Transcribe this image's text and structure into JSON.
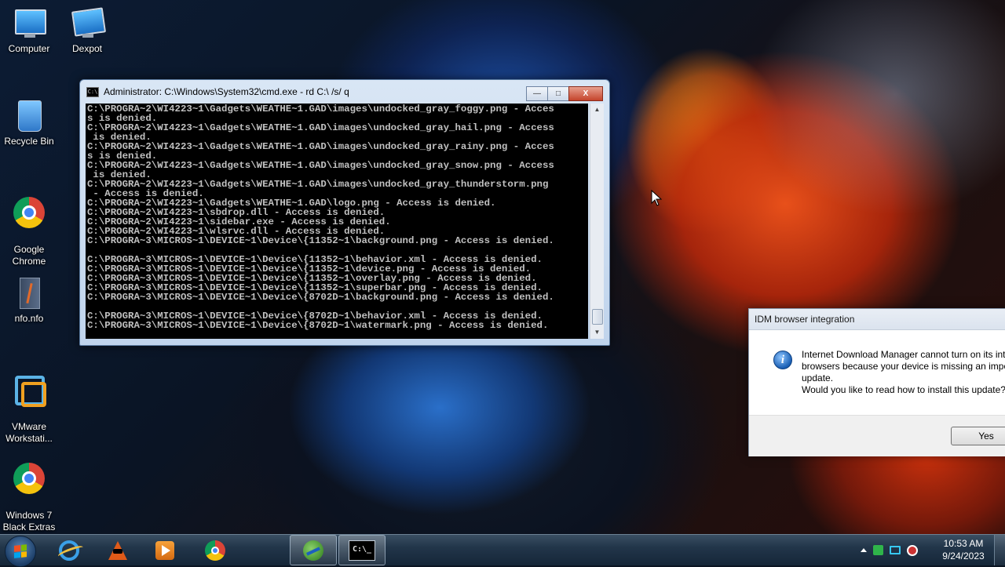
{
  "desktop_icons": [
    {
      "label": "Computer"
    },
    {
      "label": "Dexpot"
    },
    {
      "label": "Recycle Bin"
    },
    {
      "label": "Google\nChrome"
    },
    {
      "label": "nfo.nfo"
    },
    {
      "label": "VMware\nWorkstati..."
    },
    {
      "label": "Windows 7\nBlack Extras"
    }
  ],
  "cmd": {
    "title": "Administrator: C:\\Windows\\System32\\cmd.exe - rd  C:\\ /s/ q",
    "icon_text": "C:\\",
    "output": "C:\\PROGRA~2\\WI4223~1\\Gadgets\\WEATHE~1.GAD\\images\\undocked_gray_foggy.png - Acces\ns is denied.\nC:\\PROGRA~2\\WI4223~1\\Gadgets\\WEATHE~1.GAD\\images\\undocked_gray_hail.png - Access\n is denied.\nC:\\PROGRA~2\\WI4223~1\\Gadgets\\WEATHE~1.GAD\\images\\undocked_gray_rainy.png - Acces\ns is denied.\nC:\\PROGRA~2\\WI4223~1\\Gadgets\\WEATHE~1.GAD\\images\\undocked_gray_snow.png - Access\n is denied.\nC:\\PROGRA~2\\WI4223~1\\Gadgets\\WEATHE~1.GAD\\images\\undocked_gray_thunderstorm.png\n - Access is denied.\nC:\\PROGRA~2\\WI4223~1\\Gadgets\\WEATHE~1.GAD\\logo.png - Access is denied.\nC:\\PROGRA~2\\WI4223~1\\sbdrop.dll - Access is denied.\nC:\\PROGRA~2\\WI4223~1\\sidebar.exe - Access is denied.\nC:\\PROGRA~2\\WI4223~1\\wlsrvc.dll - Access is denied.\nC:\\PROGRA~3\\MICROS~1\\DEVICE~1\\Device\\{11352~1\\background.png - Access is denied.\n\nC:\\PROGRA~3\\MICROS~1\\DEVICE~1\\Device\\{11352~1\\behavior.xml - Access is denied.\nC:\\PROGRA~3\\MICROS~1\\DEVICE~1\\Device\\{11352~1\\device.png - Access is denied.\nC:\\PROGRA~3\\MICROS~1\\DEVICE~1\\Device\\{11352~1\\overlay.png - Access is denied.\nC:\\PROGRA~3\\MICROS~1\\DEVICE~1\\Device\\{11352~1\\superbar.png - Access is denied.\nC:\\PROGRA~3\\MICROS~1\\DEVICE~1\\Device\\{8702D~1\\background.png - Access is denied.\n\nC:\\PROGRA~3\\MICROS~1\\DEVICE~1\\Device\\{8702D~1\\behavior.xml - Access is denied.\nC:\\PROGRA~3\\MICROS~1\\DEVICE~1\\Device\\{8702D~1\\watermark.png - Access is denied.",
    "buttons": {
      "minimize": "—",
      "maximize": "□",
      "close": "X"
    }
  },
  "idm_dialog": {
    "title": "IDM browser integration",
    "message": "Internet Download Manager cannot turn on its integration into\nbrowsers because your device is missing an important Windows\nupdate.\nWould you like to read how to install this update?",
    "yes_label": "Yes",
    "icon_glyph": "i"
  },
  "taskbar": {
    "cmd_icon_text": "C:\\_",
    "clock_time": "10:53 AM",
    "clock_date": "9/24/2023"
  }
}
